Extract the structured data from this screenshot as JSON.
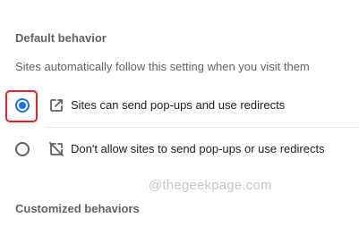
{
  "section": {
    "heading": "Default behavior",
    "description": "Sites automatically follow this setting when you visit them"
  },
  "options": [
    {
      "label": "Sites can send pop-ups and use redirects",
      "icon": "open-in-new-icon",
      "selected": true
    },
    {
      "label": "Don't allow sites to send pop-ups or use redirects",
      "icon": "pop-ups-blocked-icon",
      "selected": false
    }
  ],
  "customized": {
    "heading": "Customized behaviors"
  },
  "watermark": "@thegeekpage.com",
  "colors": {
    "accent": "#1a73e8",
    "highlight": "#e8202a",
    "secondary_text": "#5f6368",
    "watermark": "#c7c7c7"
  }
}
